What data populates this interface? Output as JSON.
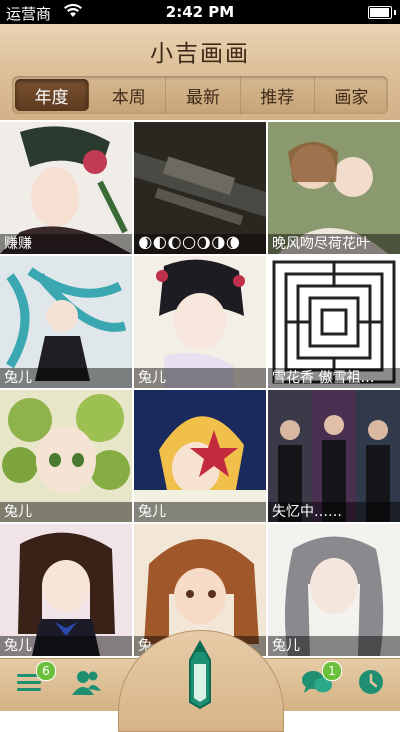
{
  "status": {
    "carrier": "运营商",
    "time": "2:42 PM"
  },
  "header": {
    "title": "小吉画画"
  },
  "tabs": [
    {
      "label": "年度",
      "active": true
    },
    {
      "label": "本周",
      "active": false
    },
    {
      "label": "最新",
      "active": false
    },
    {
      "label": "推荐",
      "active": false
    },
    {
      "label": "画家",
      "active": false
    }
  ],
  "tiles": [
    {
      "caption": "赚赚"
    },
    {
      "caption": "🌒🌓🌔🌕🌖🌗🌘"
    },
    {
      "caption": "晚风吻尽荷花叶"
    },
    {
      "caption": "兔儿"
    },
    {
      "caption": "兔儿"
    },
    {
      "caption": "雪花香 傲雪祖…"
    },
    {
      "caption": "兔儿"
    },
    {
      "caption": "兔儿"
    },
    {
      "caption": "失忆中……"
    },
    {
      "caption": "兔儿"
    },
    {
      "caption": "兔"
    },
    {
      "caption": "兔儿"
    }
  ],
  "toolbar": {
    "menu_badge": "6",
    "chat_badge": "1",
    "accent": "#1f8f72"
  }
}
